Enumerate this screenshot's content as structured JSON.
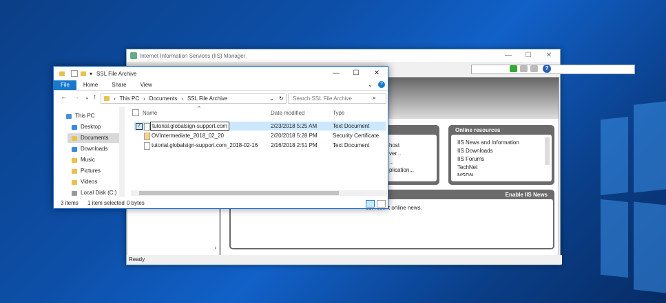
{
  "iis": {
    "title": "Internet Information Services (IIS) Manager",
    "min": "—",
    "max": "☐",
    "close": "✕",
    "panel_left_header": "s",
    "panel_left_items": [
      "host",
      "ver...",
      "...",
      "plication..."
    ],
    "online_header": "Online resources",
    "online_items": [
      "IIS News and Information",
      "IIS Downloads",
      "IIS Forums",
      "TechNet",
      "MSDN"
    ],
    "news_header": "Enable IIS News",
    "news_text": "ost recent online news.",
    "status": "Ready"
  },
  "explorer": {
    "title": "SSL File Archive",
    "min": "—",
    "max": "☐",
    "close": "✕",
    "tabs": [
      "File",
      "Home",
      "Share",
      "View"
    ],
    "breadcrumb": [
      "This PC",
      "Documents",
      "SSL File Archive"
    ],
    "search_placeholder": "Search SSL File Archive",
    "sidebar": [
      "This PC",
      "Desktop",
      "Documents",
      "Downloads",
      "Music",
      "Pictures",
      "Videos",
      "Local Disk (C:)"
    ],
    "columns": [
      "Name",
      "Date modified",
      "Type"
    ],
    "files": [
      {
        "name": "tutorial.globalsign-support.com",
        "date": "2/23/2018 5:25 AM",
        "type": "Text Document"
      },
      {
        "name": "OVIntermediate_2018_02_20",
        "date": "2/20/2018 5:28 PM",
        "type": "Security Certificate"
      },
      {
        "name": "tutorial.globalsign-support.com_2018-02-16",
        "date": "2/16/2018 2:51 PM",
        "type": "Text Document"
      }
    ],
    "status_items": "3 items",
    "status_selected": "1 item selected",
    "status_size": "0 bytes"
  },
  "colors": {
    "accent": "#1979ca",
    "selection": "#cce8ff",
    "wallpaper": "#0d4fa8"
  }
}
